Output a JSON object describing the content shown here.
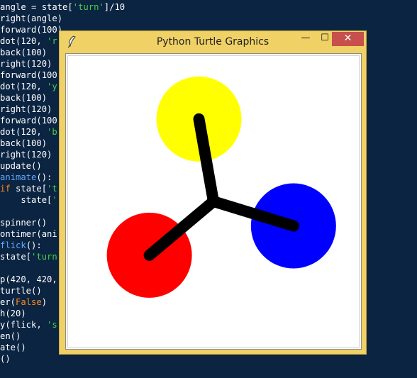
{
  "editor": {
    "lines": [
      [
        {
          "t": "angle = state["
        },
        {
          "t": "'turn'",
          "c": "tok-str"
        },
        {
          "t": "]/10"
        }
      ],
      [
        {
          "t": "right(angle)"
        }
      ],
      [
        {
          "t": "forward(100)"
        }
      ],
      [
        {
          "t": "dot(120, "
        },
        {
          "t": "'r",
          "c": "tok-str"
        }
      ],
      [
        {
          "t": "back(100)"
        }
      ],
      [
        {
          "t": "right(120)"
        }
      ],
      [
        {
          "t": "forward(100"
        }
      ],
      [
        {
          "t": "dot(120, "
        },
        {
          "t": "'y",
          "c": "tok-str"
        }
      ],
      [
        {
          "t": "back(100)"
        }
      ],
      [
        {
          "t": "right(120)"
        }
      ],
      [
        {
          "t": "forward(100"
        }
      ],
      [
        {
          "t": "dot(120, "
        },
        {
          "t": "'b",
          "c": "tok-str"
        }
      ],
      [
        {
          "t": "back(100)"
        }
      ],
      [
        {
          "t": "right(120)"
        }
      ],
      [
        {
          "t": "update()"
        }
      ],
      [
        {
          "t": "animate",
          "c": "tok-fn"
        },
        {
          "t": "():"
        }
      ],
      [
        {
          "t": "if",
          "c": "tok-kw"
        },
        {
          "t": " state["
        },
        {
          "t": "'t",
          "c": "tok-str"
        }
      ],
      [
        {
          "t": "    state["
        },
        {
          "t": "'",
          "c": "tok-str"
        }
      ],
      [
        {
          "t": ""
        }
      ],
      [
        {
          "t": "spinner()"
        }
      ],
      [
        {
          "t": "ontimer(ani"
        }
      ],
      [
        {
          "t": "flick",
          "c": "tok-fn"
        },
        {
          "t": "():"
        }
      ],
      [
        {
          "t": "state["
        },
        {
          "t": "'turn",
          "c": "tok-str"
        }
      ],
      [
        {
          "t": ""
        }
      ],
      [
        {
          "t": "p(420, 420,"
        }
      ],
      [
        {
          "t": "turtle()"
        }
      ],
      [
        {
          "t": "er("
        },
        {
          "t": "False",
          "c": "tok-bool"
        },
        {
          "t": ")"
        }
      ],
      [
        {
          "t": "h(20)"
        }
      ],
      [
        {
          "t": "y(flick, "
        },
        {
          "t": "'s",
          "c": "tok-str"
        }
      ],
      [
        {
          "t": "en()"
        }
      ],
      [
        {
          "t": "ate()"
        }
      ],
      [
        {
          "t": "()"
        }
      ]
    ]
  },
  "window": {
    "title": "Python Turtle Graphics",
    "icon": "feather-icon",
    "minimize_label": "—",
    "maximize_label": "☐",
    "close_label": "✕"
  },
  "turtle_scene": {
    "dots": [
      {
        "name": "yellow-dot",
        "color": "#ffff00",
        "angle_deg": 100
      },
      {
        "name": "blue-dot",
        "color": "#0000ff",
        "angle_deg": -17
      },
      {
        "name": "red-dot",
        "color": "#ff0000",
        "angle_deg": 220
      }
    ],
    "dot_size": 120,
    "arm_length": 100,
    "arm_color": "#000000"
  }
}
